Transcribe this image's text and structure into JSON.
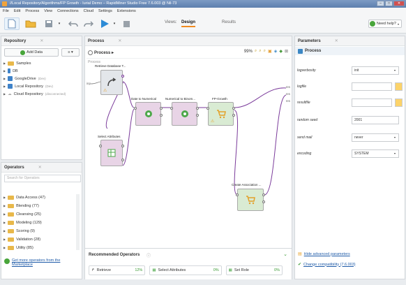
{
  "window": {
    "title": "//Local Repository/Algorithms/FP Growth - Iurial Demo – RapidMiner Studio Free 7.6.003 @ Nil-73",
    "controls": [
      "–",
      "□",
      "✕"
    ]
  },
  "menu": [
    "File",
    "Edit",
    "Process",
    "View",
    "Connections",
    "Cloud",
    "Settings",
    "Extensions"
  ],
  "views": {
    "label": "Views:",
    "design": "Design",
    "results": "Results"
  },
  "help": {
    "label": "Need help?"
  },
  "repository": {
    "tab": "Repository",
    "add_data": "Add Data",
    "menu_btn": "≡ ▾",
    "items": [
      {
        "label": "Samples",
        "tag": "",
        "icon": "folder"
      },
      {
        "label": "DB",
        "tag": "",
        "icon": "db"
      },
      {
        "label": "GoogleDrive",
        "tag": "(Dev)",
        "icon": "db"
      },
      {
        "label": "Local Repository",
        "tag": "(Dev)",
        "icon": "db"
      },
      {
        "label": "Cloud Repository",
        "tag": "(disconnected)",
        "icon": "cloud"
      }
    ]
  },
  "operators": {
    "tab": "Operators",
    "search_placeholder": "Search for Operators",
    "items": [
      {
        "label": "Data Access (47)"
      },
      {
        "label": "Blending (77)"
      },
      {
        "label": "Cleansing (25)"
      },
      {
        "label": "Modeling (129)"
      },
      {
        "label": "Scoring (9)"
      },
      {
        "label": "Validation (28)"
      },
      {
        "label": "Utility (85)"
      }
    ],
    "marketplace": "Get more operators from the Marketplace"
  },
  "process": {
    "tab": "Process",
    "crumb": "Process ▸",
    "zoom": "99%",
    "canvas_title": "Process",
    "nodes": [
      {
        "id": "retrieve",
        "label": "Retrieve Database T..."
      },
      {
        "id": "d2n",
        "label": "Date to Numerical"
      },
      {
        "id": "n2b",
        "label": "Numerical to Binom..."
      },
      {
        "id": "fp",
        "label": "FP-Growth"
      },
      {
        "id": "sel",
        "label": "Select Attributes"
      },
      {
        "id": "ca",
        "label": "Create Association ..."
      }
    ],
    "in_port": "inp",
    "out_ports": [
      "res",
      "res",
      "res"
    ]
  },
  "recommended": {
    "title": "Recommended Operators",
    "items": [
      {
        "label": "Retrieve",
        "pct": "12%"
      },
      {
        "label": "Select Attributes",
        "pct": "0%"
      },
      {
        "label": "Set Role",
        "pct": "0%"
      }
    ]
  },
  "parameters": {
    "tab": "Parameters",
    "header": "Process",
    "rows": [
      {
        "label": "logverbosity",
        "value": "init",
        "type": "select"
      },
      {
        "label": "logfile",
        "value": "",
        "type": "file"
      },
      {
        "label": "resultfile",
        "value": "",
        "type": "file"
      },
      {
        "label": "random seed",
        "value": "2001",
        "type": "text"
      },
      {
        "label": "send mail",
        "value": "never",
        "type": "select"
      },
      {
        "label": "encoding",
        "value": "SYSTEM",
        "type": "select"
      }
    ],
    "hide_advanced": "Hide advanced parameters",
    "compat": "Change compatibility (7.6.003)"
  }
}
